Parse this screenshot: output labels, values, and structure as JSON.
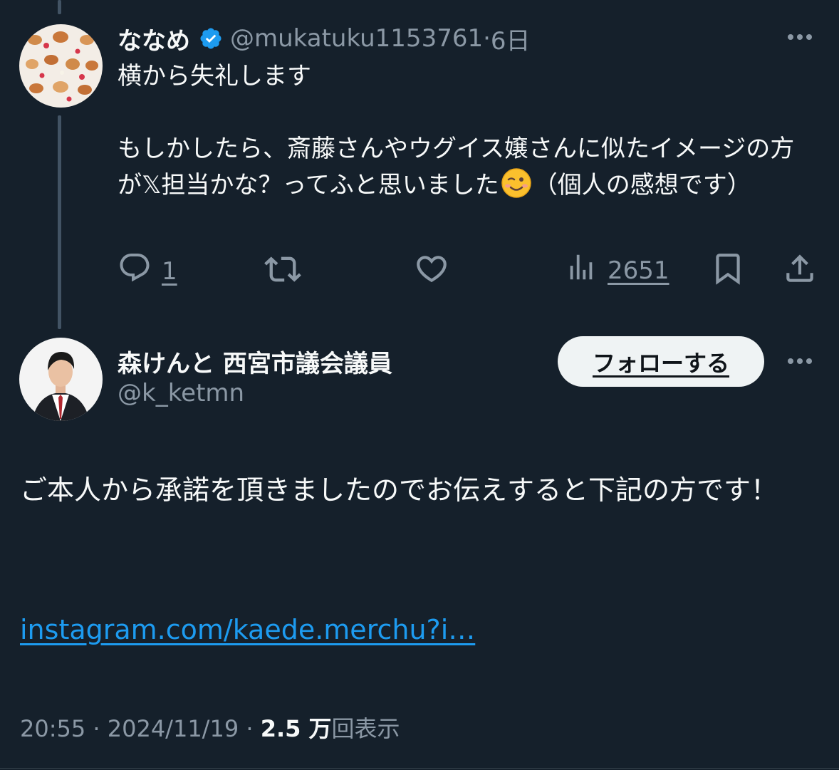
{
  "reply": {
    "name": "ななめ",
    "handle": "@mukatuku1153761",
    "separator": " · ",
    "time": "6日",
    "text_lines": [
      "横から失礼します",
      "",
      "もしかしたら、斎藤さんやウグイス嬢さんに似たイメージの方が𝕏担当かな？ってふと思いました",
      "（個人の感想です）"
    ],
    "text_line1": "横から失礼します",
    "text_para2_before_emoji": "もしかしたら、斎藤さんやウグイス嬢さんに似たイメージの方が𝕏担当かな？ってふと思いました",
    "text_para2_after_emoji": "（個人の感想です）",
    "emoji": "winking-face",
    "stats": {
      "replies": "1",
      "views": "2651"
    },
    "icons": {
      "verified": "verified-badge-icon",
      "reply": "reply-icon",
      "retweet": "retweet-icon",
      "like": "heart-icon",
      "views": "views-icon",
      "bookmark": "bookmark-icon",
      "share": "share-icon",
      "more": "more-icon"
    }
  },
  "main": {
    "name": "森けんと 西宮市議会議員",
    "handle": "@k_ketmn",
    "follow_label": "フォローする",
    "text": "ご本人から承諾を頂きましたのでお伝えすると下記の方です！",
    "link": "instagram.com/kaede.merchu?i…",
    "meta": {
      "time": "20:55",
      "date": "2024/11/19",
      "views_count": "2.5 万",
      "views_label": "回表示"
    }
  },
  "colors": {
    "background": "#15202b",
    "text_primary": "#f7f9f9",
    "text_secondary": "#8b98a5",
    "link": "#1d9bf0",
    "verified": "#1d9bf0",
    "thread_line": "#425364",
    "follow_button": "#eff3f4"
  }
}
